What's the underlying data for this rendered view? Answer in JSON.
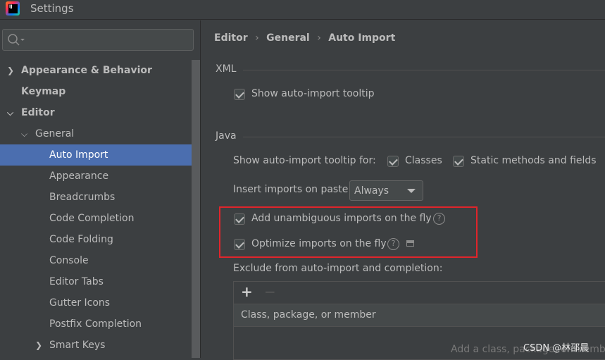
{
  "window": {
    "title": "Settings",
    "logo_text": "IJ"
  },
  "search": {
    "placeholder": ""
  },
  "sidebar": {
    "items": [
      {
        "label": "Appearance & Behavior",
        "bold": true,
        "expander": "collapsed"
      },
      {
        "label": "Keymap",
        "bold": true
      },
      {
        "label": "Editor",
        "bold": true,
        "expander": "expanded"
      },
      {
        "label": "General",
        "expander": "expanded"
      },
      {
        "label": "Auto Import",
        "selected": true
      },
      {
        "label": "Appearance"
      },
      {
        "label": "Breadcrumbs"
      },
      {
        "label": "Code Completion"
      },
      {
        "label": "Code Folding"
      },
      {
        "label": "Console"
      },
      {
        "label": "Editor Tabs"
      },
      {
        "label": "Gutter Icons"
      },
      {
        "label": "Postfix Completion"
      },
      {
        "label": "Smart Keys",
        "expander": "collapsed"
      }
    ]
  },
  "breadcrumb": [
    "Editor",
    "General",
    "Auto Import"
  ],
  "xml": {
    "section": "XML",
    "show_tooltip": {
      "label": "Show auto-import tooltip",
      "checked": true
    }
  },
  "java": {
    "section": "Java",
    "tooltip_for_label": "Show auto-import tooltip for:",
    "classes": {
      "label": "Classes",
      "checked": true
    },
    "static": {
      "label": "Static methods and fields",
      "checked": true
    },
    "insert_label": "Insert imports on paste:",
    "insert_value": "Always",
    "add_unambiguous": {
      "label": "Add unambiguous imports on the fly",
      "checked": true
    },
    "optimize": {
      "label": "Optimize imports on the fly",
      "checked": true
    },
    "exclude_label": "Exclude from auto-import and completion:",
    "add_btn": "+",
    "remove_btn": "−",
    "column": "Class, package, or member",
    "empty_text": "Add a class, package, or member"
  },
  "highlight_color": "#e0252b",
  "accent": "#4b6eaf",
  "watermark": "CSDN @林邵晨"
}
